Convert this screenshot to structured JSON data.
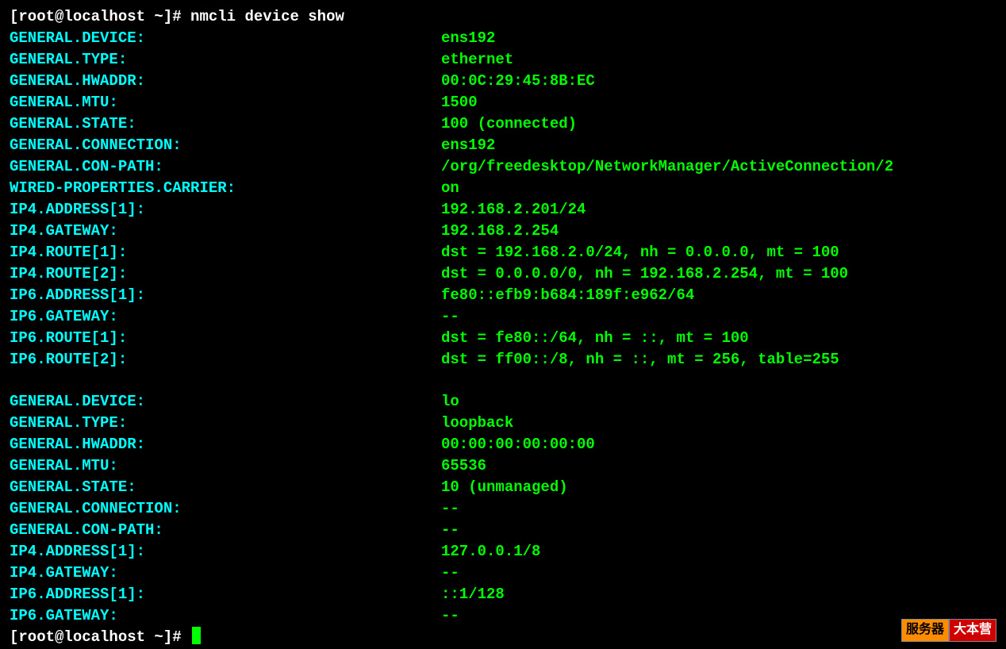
{
  "prompt1": {
    "prefix": "[root@localhost ~]# ",
    "command": "nmcli device show"
  },
  "dev1": {
    "general_device": {
      "k": "GENERAL.DEVICE:",
      "v": "ens192"
    },
    "general_type": {
      "k": "GENERAL.TYPE:",
      "v": "ethernet"
    },
    "general_hwaddr": {
      "k": "GENERAL.HWADDR:",
      "v": "00:0C:29:45:8B:EC"
    },
    "general_mtu": {
      "k": "GENERAL.MTU:",
      "v": "1500"
    },
    "general_state": {
      "k": "GENERAL.STATE:",
      "v": "100 (connected)"
    },
    "general_conn": {
      "k": "GENERAL.CONNECTION:",
      "v": "ens192"
    },
    "general_conpath": {
      "k": "GENERAL.CON-PATH:",
      "v": "/org/freedesktop/NetworkManager/ActiveConnection/2"
    },
    "wired_carrier": {
      "k": "WIRED-PROPERTIES.CARRIER:",
      "v": "on"
    },
    "ip4_addr1": {
      "k": "IP4.ADDRESS[1]:",
      "v": "192.168.2.201/24"
    },
    "ip4_gateway": {
      "k": "IP4.GATEWAY:",
      "v": "192.168.2.254"
    },
    "ip4_route1": {
      "k": "IP4.ROUTE[1]:",
      "v": "dst = 192.168.2.0/24, nh = 0.0.0.0, mt = 100"
    },
    "ip4_route2": {
      "k": "IP4.ROUTE[2]:",
      "v": "dst = 0.0.0.0/0, nh = 192.168.2.254, mt = 100"
    },
    "ip6_addr1": {
      "k": "IP6.ADDRESS[1]:",
      "v": "fe80::efb9:b684:189f:e962/64"
    },
    "ip6_gateway": {
      "k": "IP6.GATEWAY:",
      "v": "--"
    },
    "ip6_route1": {
      "k": "IP6.ROUTE[1]:",
      "v": "dst = fe80::/64, nh = ::, mt = 100"
    },
    "ip6_route2": {
      "k": "IP6.ROUTE[2]:",
      "v": "dst = ff00::/8, nh = ::, mt = 256, table=255"
    }
  },
  "dev2": {
    "general_device": {
      "k": "GENERAL.DEVICE:",
      "v": "lo"
    },
    "general_type": {
      "k": "GENERAL.TYPE:",
      "v": "loopback"
    },
    "general_hwaddr": {
      "k": "GENERAL.HWADDR:",
      "v": "00:00:00:00:00:00"
    },
    "general_mtu": {
      "k": "GENERAL.MTU:",
      "v": "65536"
    },
    "general_state": {
      "k": "GENERAL.STATE:",
      "v": "10 (unmanaged)"
    },
    "general_conn": {
      "k": "GENERAL.CONNECTION:",
      "v": "--"
    },
    "general_conpath": {
      "k": "GENERAL.CON-PATH:",
      "v": "--"
    },
    "ip4_addr1": {
      "k": "IP4.ADDRESS[1]:",
      "v": "127.0.0.1/8"
    },
    "ip4_gateway": {
      "k": "IP4.GATEWAY:",
      "v": "--"
    },
    "ip6_addr1": {
      "k": "IP6.ADDRESS[1]:",
      "v": "::1/128"
    },
    "ip6_gateway": {
      "k": "IP6.GATEWAY:",
      "v": "--"
    }
  },
  "prompt2": {
    "prefix": "[root@localhost ~]# "
  },
  "watermark": {
    "left": "服务器",
    "right": "大本营"
  }
}
